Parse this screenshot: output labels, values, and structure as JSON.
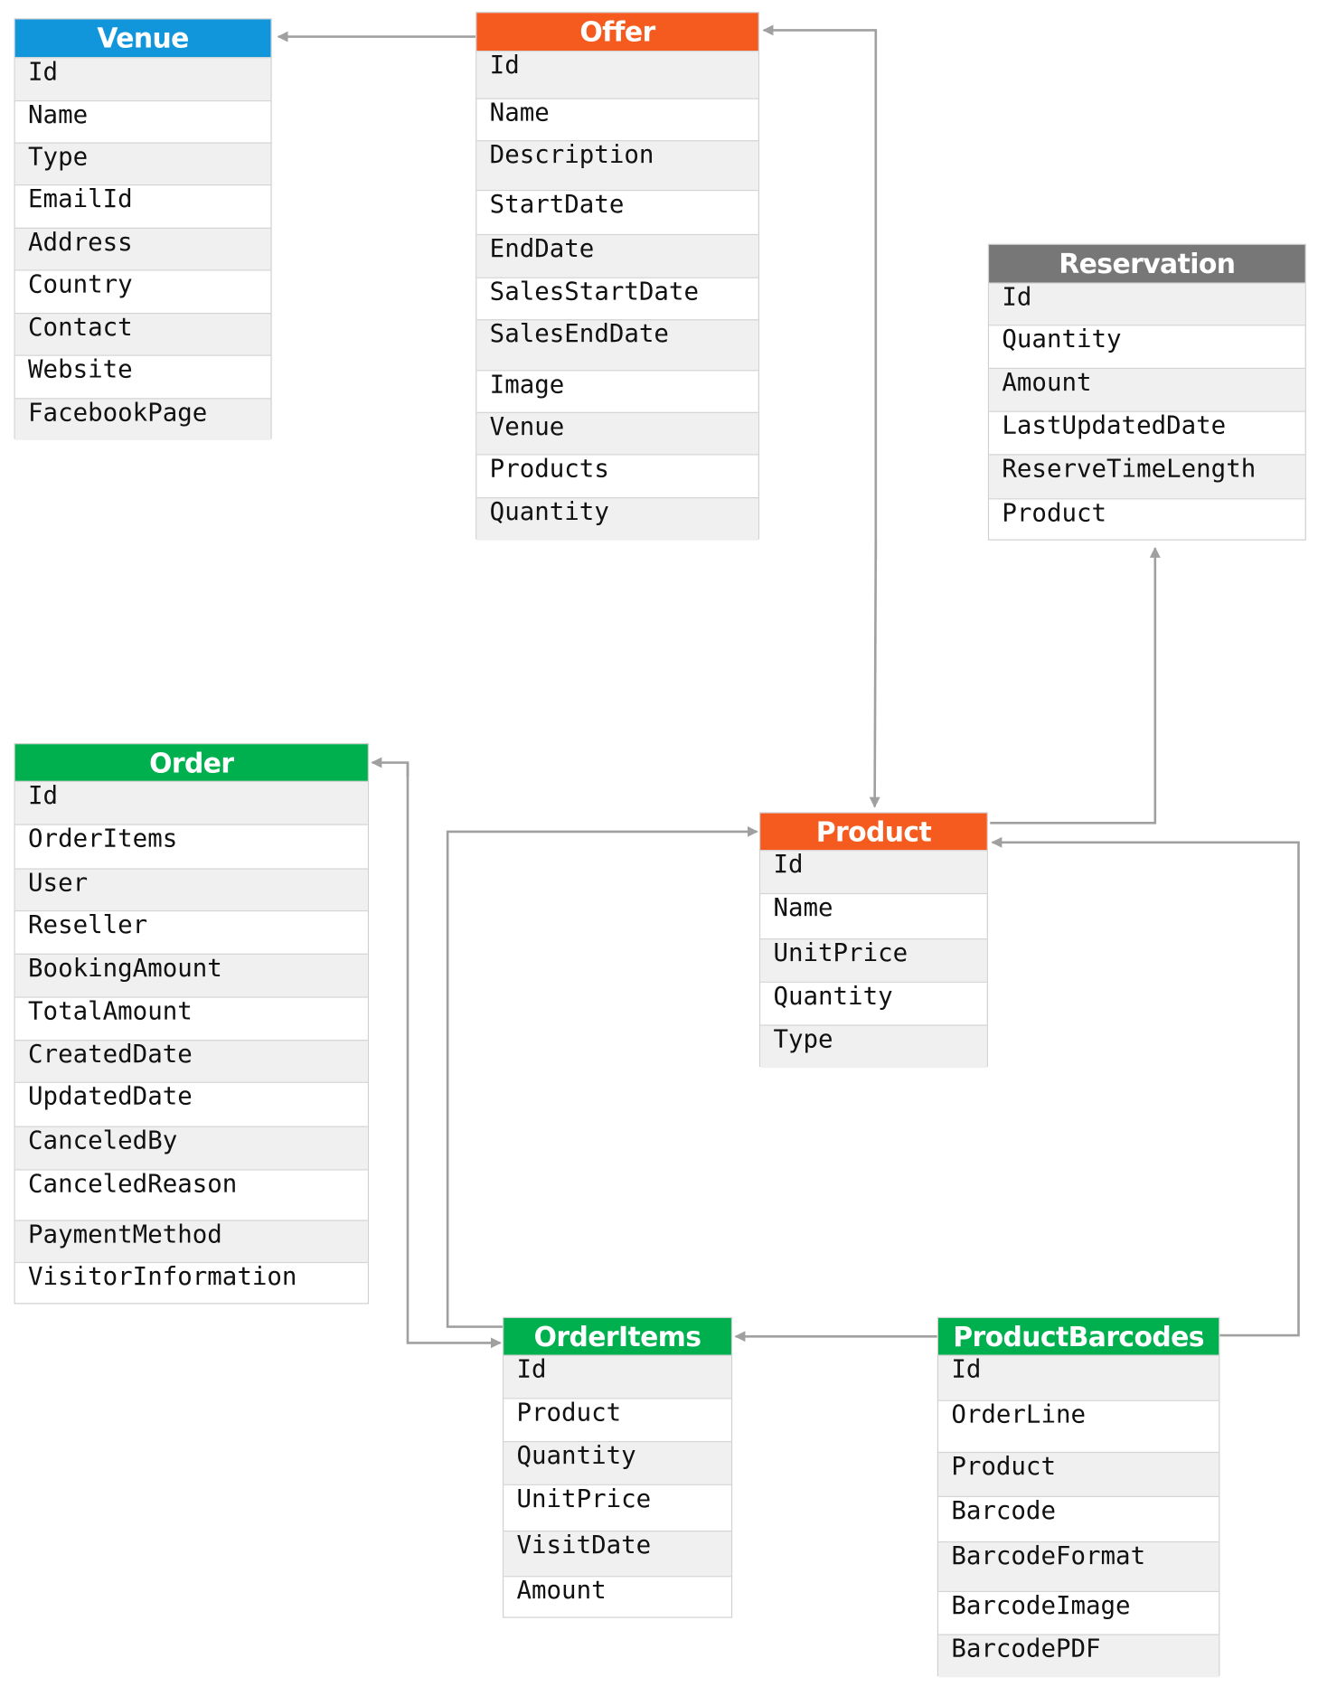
{
  "tables": [
    {
      "key": "venue",
      "title": "Venue",
      "color": "#1296db",
      "fields": [
        "Id",
        "Name",
        "Type",
        "EmailId",
        "Address",
        "Country",
        "Contact",
        "Website",
        "FacebookPage"
      ]
    },
    {
      "key": "offer",
      "title": "Offer",
      "color": "#f55b1f",
      "fields": [
        "Id",
        "Name",
        "Description",
        "StartDate",
        "EndDate",
        "SalesStartDate",
        "SalesEndDate",
        "Image",
        "Venue",
        "Products",
        "Quantity"
      ]
    },
    {
      "key": "reservation",
      "title": "Reservation",
      "color": "#777777",
      "fields": [
        "Id",
        "Quantity",
        "Amount",
        "LastUpdatedDate",
        "ReserveTimeLength",
        "Product"
      ]
    },
    {
      "key": "order",
      "title": "Order",
      "color": "#00b04f",
      "fields": [
        "Id",
        "OrderItems",
        "User",
        "Reseller",
        "BookingAmount",
        "TotalAmount",
        "CreatedDate",
        "UpdatedDate",
        "CanceledBy",
        "CanceledReason",
        "PaymentMethod",
        "VisitorInformation"
      ]
    },
    {
      "key": "product",
      "title": "Product",
      "color": "#f55b1f",
      "fields": [
        "Id",
        "Name",
        "UnitPrice",
        "Quantity",
        "Type"
      ]
    },
    {
      "key": "orderitems",
      "title": "OrderItems",
      "color": "#00b04f",
      "fields": [
        "Id",
        "Product",
        "Quantity",
        "UnitPrice",
        "VisitDate",
        "Amount"
      ]
    },
    {
      "key": "productbarcodes",
      "title": "ProductBarcodes",
      "color": "#00b04f",
      "fields": [
        "Id",
        "OrderLine",
        "Product",
        "Barcode",
        "BarcodeFormat",
        "BarcodeImage",
        "BarcodePDF"
      ]
    }
  ],
  "relationships": [
    {
      "from": "Offer",
      "to": "Venue"
    },
    {
      "from": "Product",
      "to": "Offer",
      "both_ends": true
    },
    {
      "from": "Product",
      "to": "Reservation"
    },
    {
      "from": "ProductBarcodes",
      "to": "Product"
    },
    {
      "from": "OrderItems",
      "to": "Product"
    },
    {
      "from": "Order",
      "to": "OrderItems",
      "both_ends": true
    },
    {
      "from": "ProductBarcodes",
      "to": "OrderItems"
    }
  ],
  "line_color": "#a0a0a0"
}
